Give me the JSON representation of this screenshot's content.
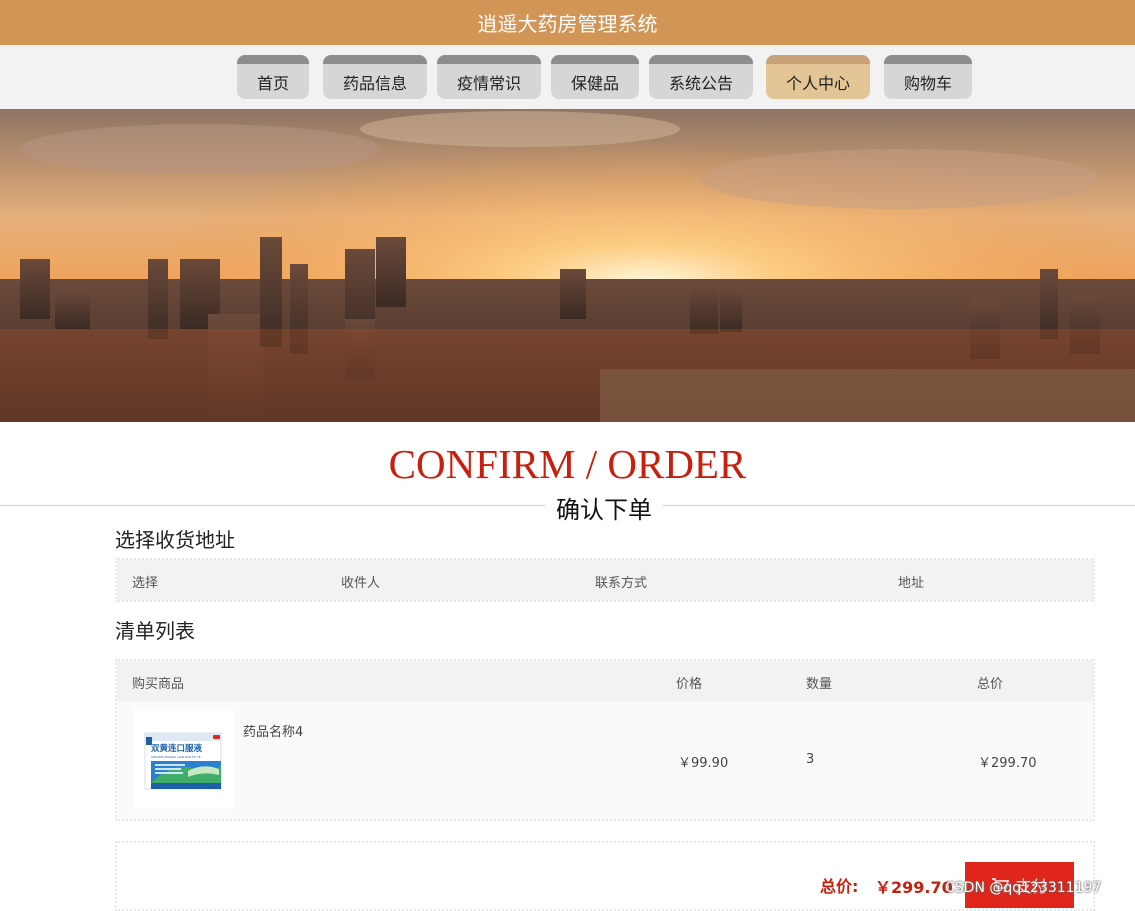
{
  "app": {
    "title": "逍遥大药房管理系统"
  },
  "nav": {
    "items": [
      "首页",
      "药品信息",
      "疫情常识",
      "保健品",
      "系统公告",
      "个人中心",
      "购物车"
    ],
    "active_index": 5
  },
  "page": {
    "heading_en": "CONFIRM / ORDER",
    "heading_cn": "确认下单"
  },
  "address_section": {
    "title": "选择收货地址",
    "columns": [
      "选择",
      "收件人",
      "联系方式",
      "地址"
    ]
  },
  "list_section": {
    "title": "清单列表",
    "columns": [
      "购买商品",
      "价格",
      "数量",
      "总价"
    ],
    "items": [
      {
        "name": "药品名称4",
        "price": "￥99.90",
        "quantity": "3",
        "subtotal": "￥299.70",
        "image_label": "双黄连口服液",
        "image_subtitle": "SHUANG HUANG LIAN KOU FU YE"
      }
    ]
  },
  "summary": {
    "total_label": "总价:",
    "total_value": "￥299.70",
    "pay_label": "支付"
  },
  "watermark": "CSDN @qq123311197",
  "colors": {
    "header": "#d19556",
    "accent": "#c8200e",
    "pay_button": "#e0261b"
  }
}
